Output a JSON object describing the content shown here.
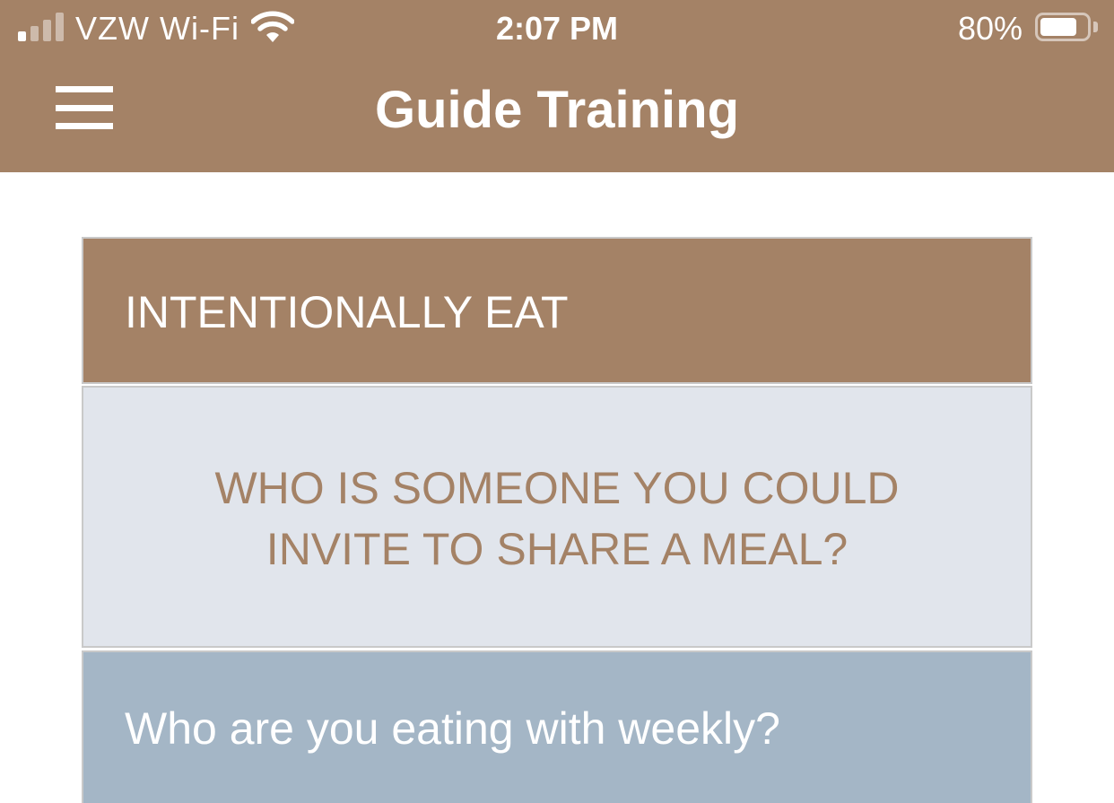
{
  "status_bar": {
    "carrier": "VZW Wi-Fi",
    "time": "2:07 PM",
    "battery_percent": "80%",
    "battery_level": 0.8,
    "signal_bars": 1,
    "signal_bars_total": 4
  },
  "header": {
    "title": "Guide Training",
    "menu_icon": "hamburger-menu-icon"
  },
  "content": {
    "section_title": "INTENTIONALLY EAT",
    "question_line1": "WHO IS SOMEONE YOU COULD",
    "question_line2": "INVITE TO SHARE A MEAL?",
    "prompt": "Who are you eating with weekly?"
  },
  "colors": {
    "brand": "#a48266",
    "question_bg": "#e1e5ec",
    "prompt_bg": "#a4b6c6"
  }
}
